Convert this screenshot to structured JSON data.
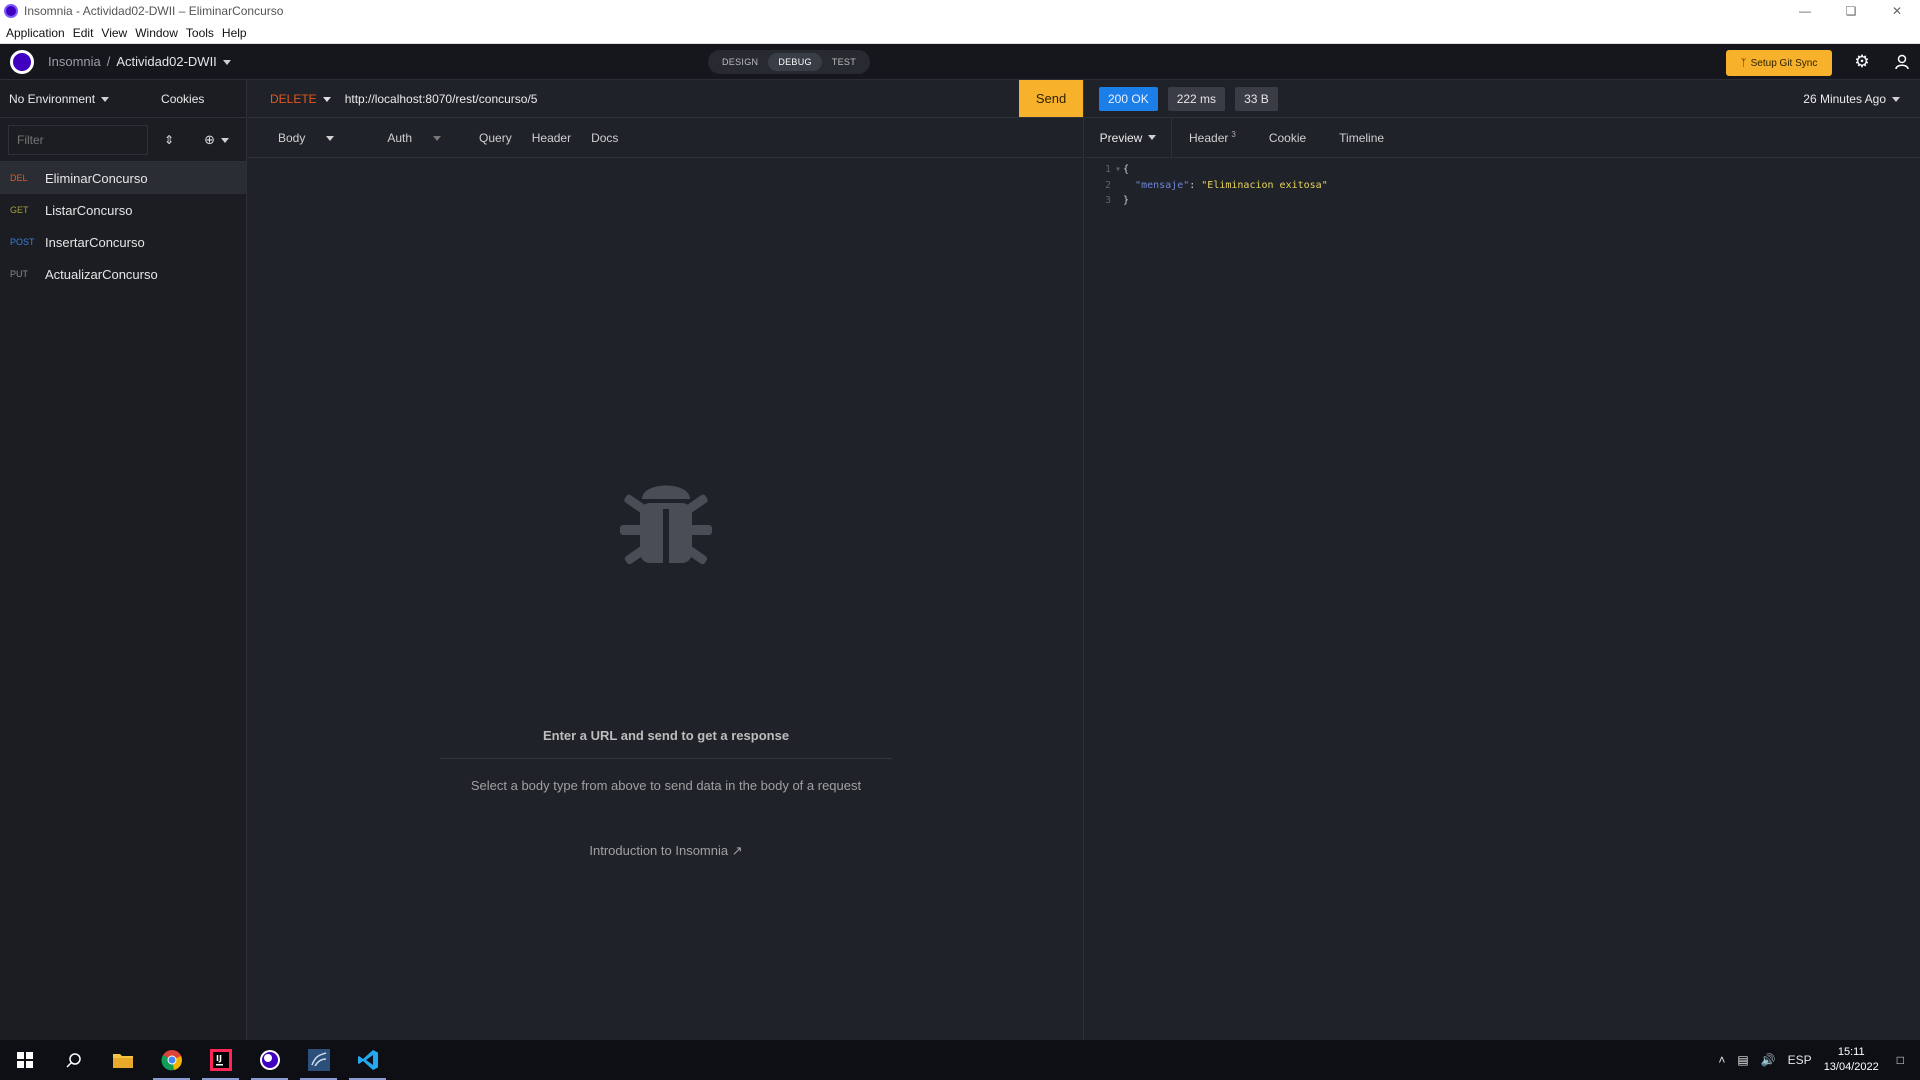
{
  "window": {
    "title": "Insomnia - Actividad02-DWII – EliminarConcurso"
  },
  "menu": [
    "Application",
    "Edit",
    "View",
    "Window",
    "Tools",
    "Help"
  ],
  "header": {
    "app_name": "Insomnia",
    "separator": "/",
    "project": "Actividad02-DWII",
    "modes": [
      "DESIGN",
      "DEBUG",
      "TEST"
    ],
    "active_mode": "DEBUG",
    "git_sync_label": "Setup Git Sync"
  },
  "sidebar": {
    "environment": "No Environment",
    "cookies_label": "Cookies",
    "filter_placeholder": "Filter",
    "requests": [
      {
        "method": "DEL",
        "name": "EliminarConcurso",
        "active": true
      },
      {
        "method": "GET",
        "name": "ListarConcurso",
        "active": false
      },
      {
        "method": "POST",
        "name": "InsertarConcurso",
        "active": false
      },
      {
        "method": "PUT",
        "name": "ActualizarConcurso",
        "active": false
      }
    ]
  },
  "request": {
    "method": "DELETE",
    "url": "http://localhost:8070/rest/concurso/5",
    "send_label": "Send",
    "tabs": [
      "Body",
      "Auth",
      "Query",
      "Header",
      "Docs"
    ],
    "empty_title": "Enter a URL and send to get a response",
    "empty_subtitle": "Select a body type from above to send data in the body of a request",
    "intro_link": "Introduction to Insomnia"
  },
  "response": {
    "status": "200 OK",
    "time": "222 ms",
    "size": "33 B",
    "ago": "26 Minutes Ago",
    "tabs": {
      "preview": "Preview",
      "header": "Header",
      "header_count": "3",
      "cookie": "Cookie",
      "timeline": "Timeline"
    },
    "body_lines": [
      {
        "n": "1",
        "text": "{"
      },
      {
        "n": "2",
        "key": "\"mensaje\"",
        "sep": ": ",
        "value": "\"Eliminacion exitosa\""
      },
      {
        "n": "3",
        "text": "}"
      }
    ]
  },
  "taskbar": {
    "language": "ESP",
    "time": "15:11",
    "date": "13/04/2022"
  },
  "colors": {
    "accent_send": "#f7b12a",
    "status_ok": "#1b7ee9",
    "delete_method": "#e25822"
  }
}
